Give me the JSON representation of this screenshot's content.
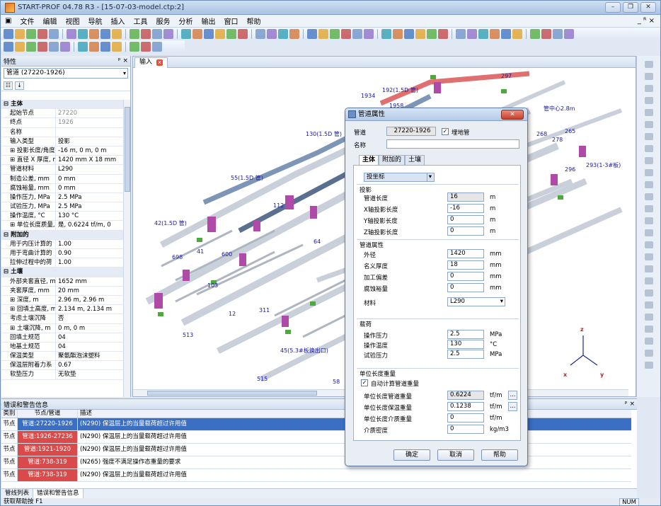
{
  "window": {
    "title": "START-PROF 04.78 R3 - [15-07-03-model.ctp:2]",
    "buttons": [
      "–",
      "❐",
      "✕"
    ]
  },
  "menu": [
    "文件",
    "编辑",
    "视图",
    "导航",
    "插入",
    "工具",
    "服务",
    "分析",
    "输出",
    "窗口",
    "帮助"
  ],
  "menu_mdi": "_ ᴿ ×",
  "props_panel": {
    "title": "特性",
    "pin": "ᵖ ×",
    "selector": "管道 (27220-1926)",
    "rows": [
      {
        "cat": true,
        "k": "主体"
      },
      {
        "k": "起始节点",
        "v": "27220",
        "grey": true
      },
      {
        "k": "终点",
        "v": "1926",
        "grey": true
      },
      {
        "k": "名称",
        "v": ""
      },
      {
        "k": "输入类型",
        "v": "投影"
      },
      {
        "k": "⊞ 投影长度/角度",
        "v": "-16 m, 0 m, 0 m"
      },
      {
        "k": "⊞ 直径 X 厚度, mm",
        "v": "1420 mm X 18 mm"
      },
      {
        "k": "管道材料",
        "v": "L290"
      },
      {
        "k": "制造公差, mm",
        "v": "0 mm"
      },
      {
        "k": "腐蚀裕量, mm",
        "v": "0 mm"
      },
      {
        "k": "操作压力, MPa",
        "v": "2.5 MPa"
      },
      {
        "k": "试验压力, MPa",
        "v": "2.5 MPa"
      },
      {
        "k": "操作温度, °C",
        "v": "130 °C"
      },
      {
        "k": "⊞ 单位长度质量, t",
        "v": "是, 0.6224 tf/m, 0"
      },
      {
        "cat": true,
        "k": "附加的"
      },
      {
        "k": "用于内压计算的",
        "v": "1.00"
      },
      {
        "k": "用于弯曲计算的",
        "v": "0.90"
      },
      {
        "k": "拉伸过程中的荷",
        "v": "1.00"
      },
      {
        "cat": true,
        "k": "土壤"
      },
      {
        "k": "外部夹套直径, mm",
        "v": "1652 mm"
      },
      {
        "k": "夹套厚度, mm",
        "v": "20 mm"
      },
      {
        "k": "⊞ 深度, m",
        "v": "2.96 m, 2.96 m"
      },
      {
        "k": "⊞ 回填土高度, m",
        "v": "2.134 m, 2.134 m"
      },
      {
        "k": "考虑土壤沉降",
        "v": "否"
      },
      {
        "k": "⊞ 土壤沉降, m",
        "v": "0 m, 0 m"
      },
      {
        "k": "回填土规范",
        "v": "04"
      },
      {
        "k": "地基土规范",
        "v": "04"
      },
      {
        "k": "保温类型",
        "v": "聚氨酯泡沫塑料"
      },
      {
        "k": "保温层附着力系",
        "v": "0.67"
      },
      {
        "k": "软垫压力",
        "v": "无软垫"
      }
    ]
  },
  "doc_tab": "输入",
  "model_labels": [
    "1934",
    "192(1.5D 管)",
    "297",
    "1958",
    "130(1.5D 管)",
    "55(1.5D 管)",
    "112",
    "42(1.5D 管)",
    "64",
    "698",
    "600",
    "41",
    "103",
    "12",
    "311",
    "513",
    "515",
    "58",
    "45(5.3#板换出口)",
    "293(1-3#板)",
    "265",
    "268",
    "278",
    "296",
    "27",
    "管中心2.8m",
    "x",
    "y",
    "z"
  ],
  "dialog": {
    "title": "管道属性",
    "pipe_label": "管道",
    "pipe_value": "27220-1926",
    "buried_label": "埋地管",
    "name_label": "名称",
    "tabs": [
      "主体",
      "附加的",
      "土壤"
    ],
    "coord_type": "投坐标",
    "proj_group": "投影",
    "proj_rows": [
      {
        "k": "管道长度",
        "v": "16",
        "u": "m",
        "ro": true
      },
      {
        "k": "X轴投影长度",
        "v": "-16",
        "u": "m"
      },
      {
        "k": "Y轴投影长度",
        "v": "0",
        "u": "m"
      },
      {
        "k": "Z轴投影长度",
        "v": "0",
        "u": "m"
      }
    ],
    "pipe_group": "管道属性",
    "pipe_rows": [
      {
        "k": "外径",
        "v": "1420",
        "u": "mm"
      },
      {
        "k": "名义厚度",
        "v": "18",
        "u": "mm"
      },
      {
        "k": "加工偏差",
        "v": "0",
        "u": "mm"
      },
      {
        "k": "腐蚀裕量",
        "v": "0",
        "u": "mm"
      }
    ],
    "material_label": "材料",
    "material_value": "L290",
    "load_group": "载荷",
    "load_rows": [
      {
        "k": "操作压力",
        "v": "2.5",
        "u": "MPa"
      },
      {
        "k": "操作温度",
        "v": "130",
        "u": "°C"
      },
      {
        "k": "试验压力",
        "v": "2.5",
        "u": "MPa"
      }
    ],
    "weight_group": "单位长度重量",
    "auto_calc": "自动计算管道重量",
    "weight_rows": [
      {
        "k": "单位长度管道重量",
        "v": "0.6224",
        "u": "tf/m",
        "ro": true
      },
      {
        "k": "单位长度保温重量",
        "v": "0.1238",
        "u": "tf/m"
      },
      {
        "k": "单位长度介质重量",
        "v": "0",
        "u": "tf/m"
      },
      {
        "k": "介质密度",
        "v": "0",
        "u": "kg/m3"
      }
    ],
    "ok": "确定",
    "cancel": "取消",
    "help": "帮助"
  },
  "errors": {
    "title": "错误和警告信息",
    "cols": [
      "类别",
      "节点/管道",
      "描述"
    ],
    "rows": [
      {
        "type": "节点",
        "item": "管道:27220-1926",
        "desc": "(N290) 保温层上的当量载荷超过许用值",
        "sel": true
      },
      {
        "type": "节点",
        "item": "管道:1926-27236",
        "desc": "(N290) 保温层上的当量载荷超过许用值"
      },
      {
        "type": "节点",
        "item": "管道:1921-1920",
        "desc": "(N290) 保温层上的当量载荷超过许用值"
      },
      {
        "type": "节点",
        "item": "管道:738-319",
        "desc": "(N265) 强度不满足操作态重量的要求"
      },
      {
        "type": "节点",
        "item": "管道:738-319",
        "desc": "(N290) 保温层上的当量载荷超过许用值"
      }
    ]
  },
  "bottom_tabs": [
    "管线列表",
    "错误和警告信息"
  ],
  "status": {
    "text": "获取帮助按 F1",
    "num": "NUM"
  },
  "colors": {
    "pipe": "#c0c8d4",
    "elbow": "#b04aa8",
    "support": "#4caa3a",
    "label": "#1a1aa0",
    "error": "#d94a4a",
    "select": "#3a6fc4"
  }
}
